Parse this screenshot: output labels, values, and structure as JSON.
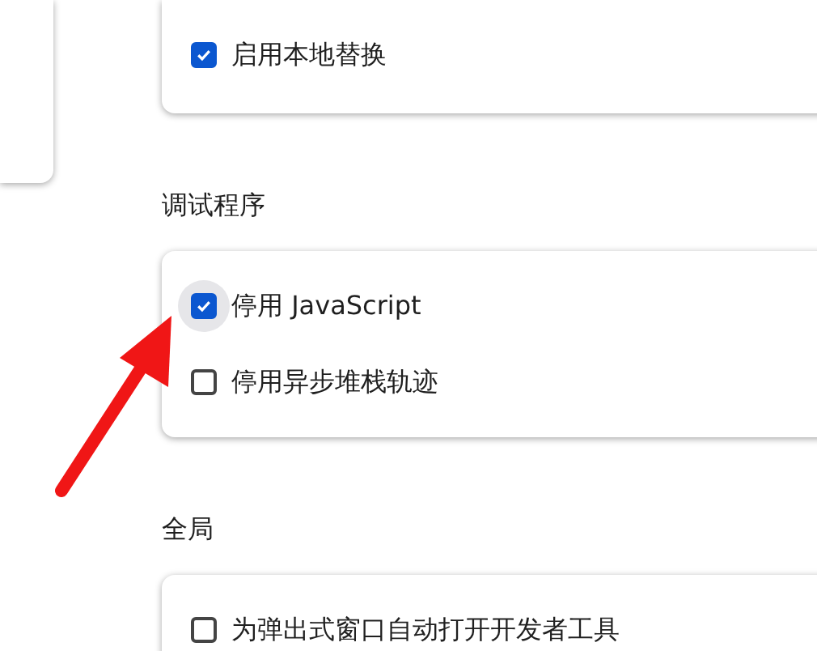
{
  "top_card": {
    "options": [
      {
        "label": "启用本地替换",
        "checked": true,
        "focused": false
      }
    ]
  },
  "sections": [
    {
      "heading": "调试程序",
      "options": [
        {
          "label": "停用 JavaScript",
          "checked": true,
          "focused": true
        },
        {
          "label": "停用异步堆栈轨迹",
          "checked": false,
          "focused": false
        }
      ]
    },
    {
      "heading": "全局",
      "options": [
        {
          "label": "为弹出式窗口自动打开开发者工具",
          "checked": false,
          "focused": false
        }
      ]
    }
  ]
}
